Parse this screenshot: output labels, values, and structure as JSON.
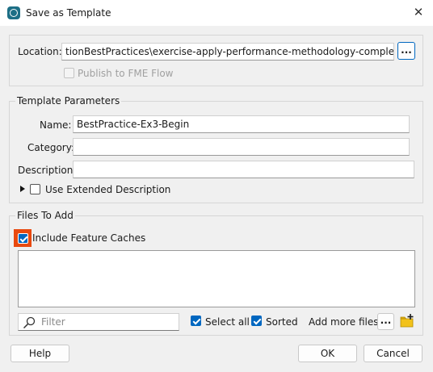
{
  "window": {
    "title": "Save as Template",
    "close_glyph": "✕"
  },
  "location": {
    "label": "Location:",
    "value": "tionBestPractices\\exercise-apply-performance-methodology-complete.fmwt",
    "browse_label": "...",
    "publish_label": "Publish to FME Flow",
    "publish_checked": false,
    "publish_enabled": false
  },
  "template_parameters": {
    "group_title": "Template Parameters",
    "name_label": "Name:",
    "name_value": "BestPractice-Ex3-Begin",
    "category_label": "Category:",
    "category_value": "",
    "description_label": "Description:",
    "description_value": "",
    "extended_label": "Use Extended Description",
    "extended_checked": false
  },
  "files_to_add": {
    "group_title": "Files To Add",
    "include_caches_label": "Include Feature Caches",
    "include_caches_checked": true,
    "highlight_color": "#e8490f",
    "filter_placeholder": "Filter",
    "select_all_label": "Select all",
    "select_all_checked": true,
    "sorted_label": "Sorted",
    "sorted_checked": true,
    "add_more_label": "Add more files:",
    "add_more_button_label": "..."
  },
  "footer": {
    "help": "Help",
    "ok": "OK",
    "cancel": "Cancel"
  },
  "colors": {
    "accent": "#0067c0",
    "app_icon": "#1d6f86",
    "folder_icon": "#f2c21b"
  },
  "icons": [
    "app-icon",
    "close-icon",
    "search-icon",
    "expand-triangle-icon",
    "folder-add-icon"
  ]
}
